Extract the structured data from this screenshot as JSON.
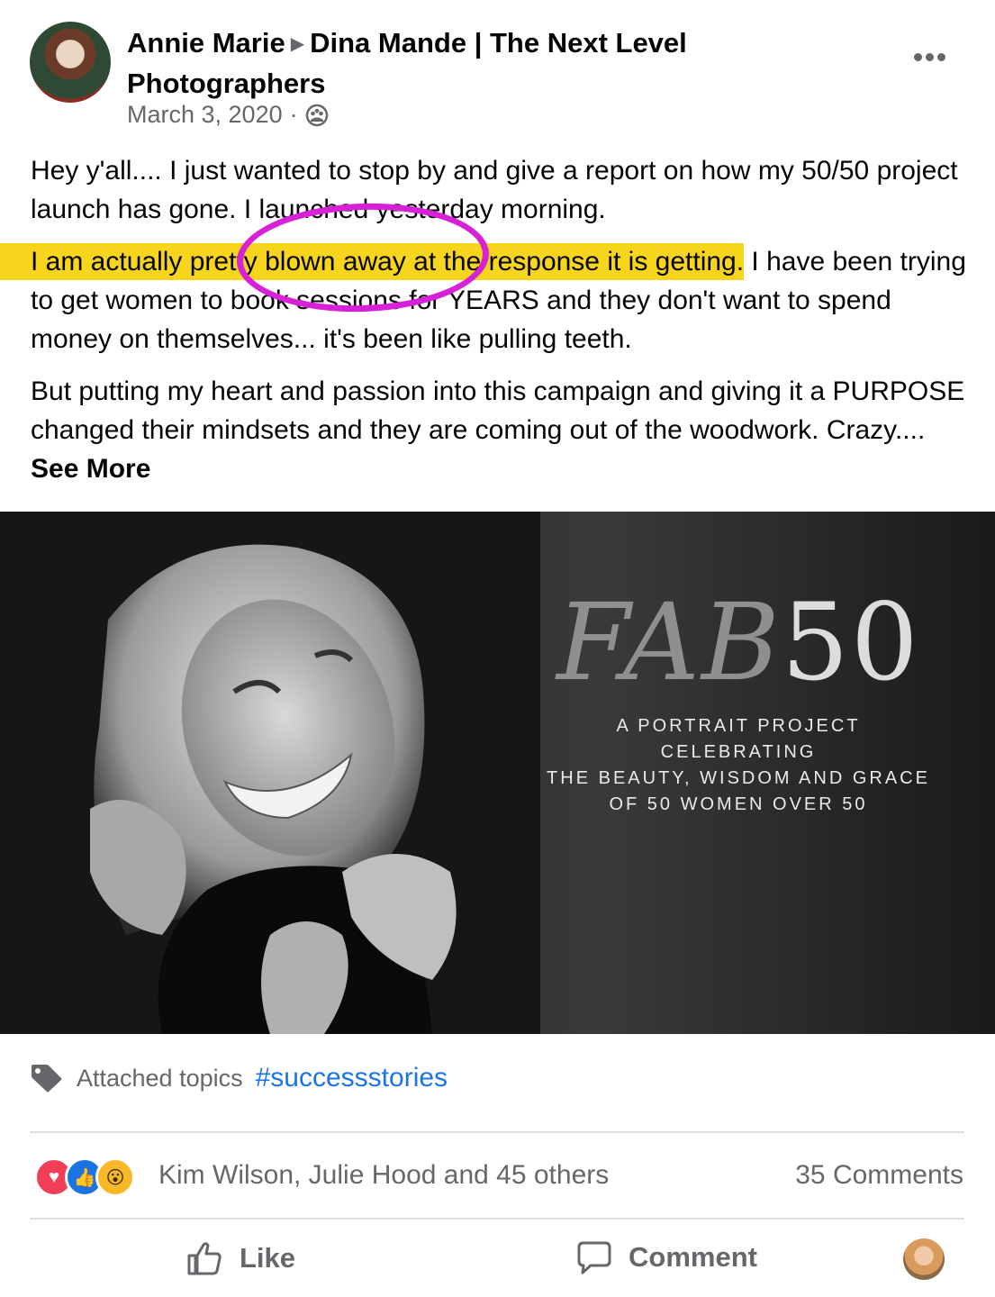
{
  "post": {
    "author": "Annie Marie",
    "group": "Dina Mande | The Next Level Photographers",
    "date": "March 3, 2020",
    "date_separator": "·",
    "paragraphs": {
      "p1": "Hey y'all.... I just wanted to stop by and give a report on how my 50/50 project launch has gone. I launched yesterday morning.",
      "p2_highlighted": "I am actually pretty blown away at the response it is getting.",
      "p2_rest": " I have been trying to get women to book sessions for YEARS and they don't want to spend money on themselves... it's been like pulling teeth.",
      "p3": "But putting my heart and passion into this campaign and giving it a PURPOSE changed their mindsets and they are coming out of the woodwork. Crazy.... "
    },
    "see_more": "See More"
  },
  "image": {
    "title_letters": "FAB",
    "title_number": "50",
    "subtitle_line1": "A PORTRAIT PROJECT CELEBRATING",
    "subtitle_line2": "THE BEAUTY, WISDOM AND GRACE",
    "subtitle_line3": "OF 50 WOMEN OVER 50"
  },
  "topics": {
    "label": "Attached topics",
    "tag": "#successstories"
  },
  "reactions": {
    "names": "Kim Wilson, Julie Hood and 45 others",
    "comments": "35 Comments"
  },
  "actions": {
    "like": "Like",
    "comment": "Comment"
  },
  "icons": {
    "privacy": "group-privacy-icon",
    "more": "more-options-icon",
    "tag": "tag-icon",
    "like": "thumbs-up-icon",
    "comment": "comment-bubble-icon"
  },
  "colors": {
    "highlight": "#f7d51d",
    "annotation": "#d621d6",
    "link": "#1b74e4"
  }
}
